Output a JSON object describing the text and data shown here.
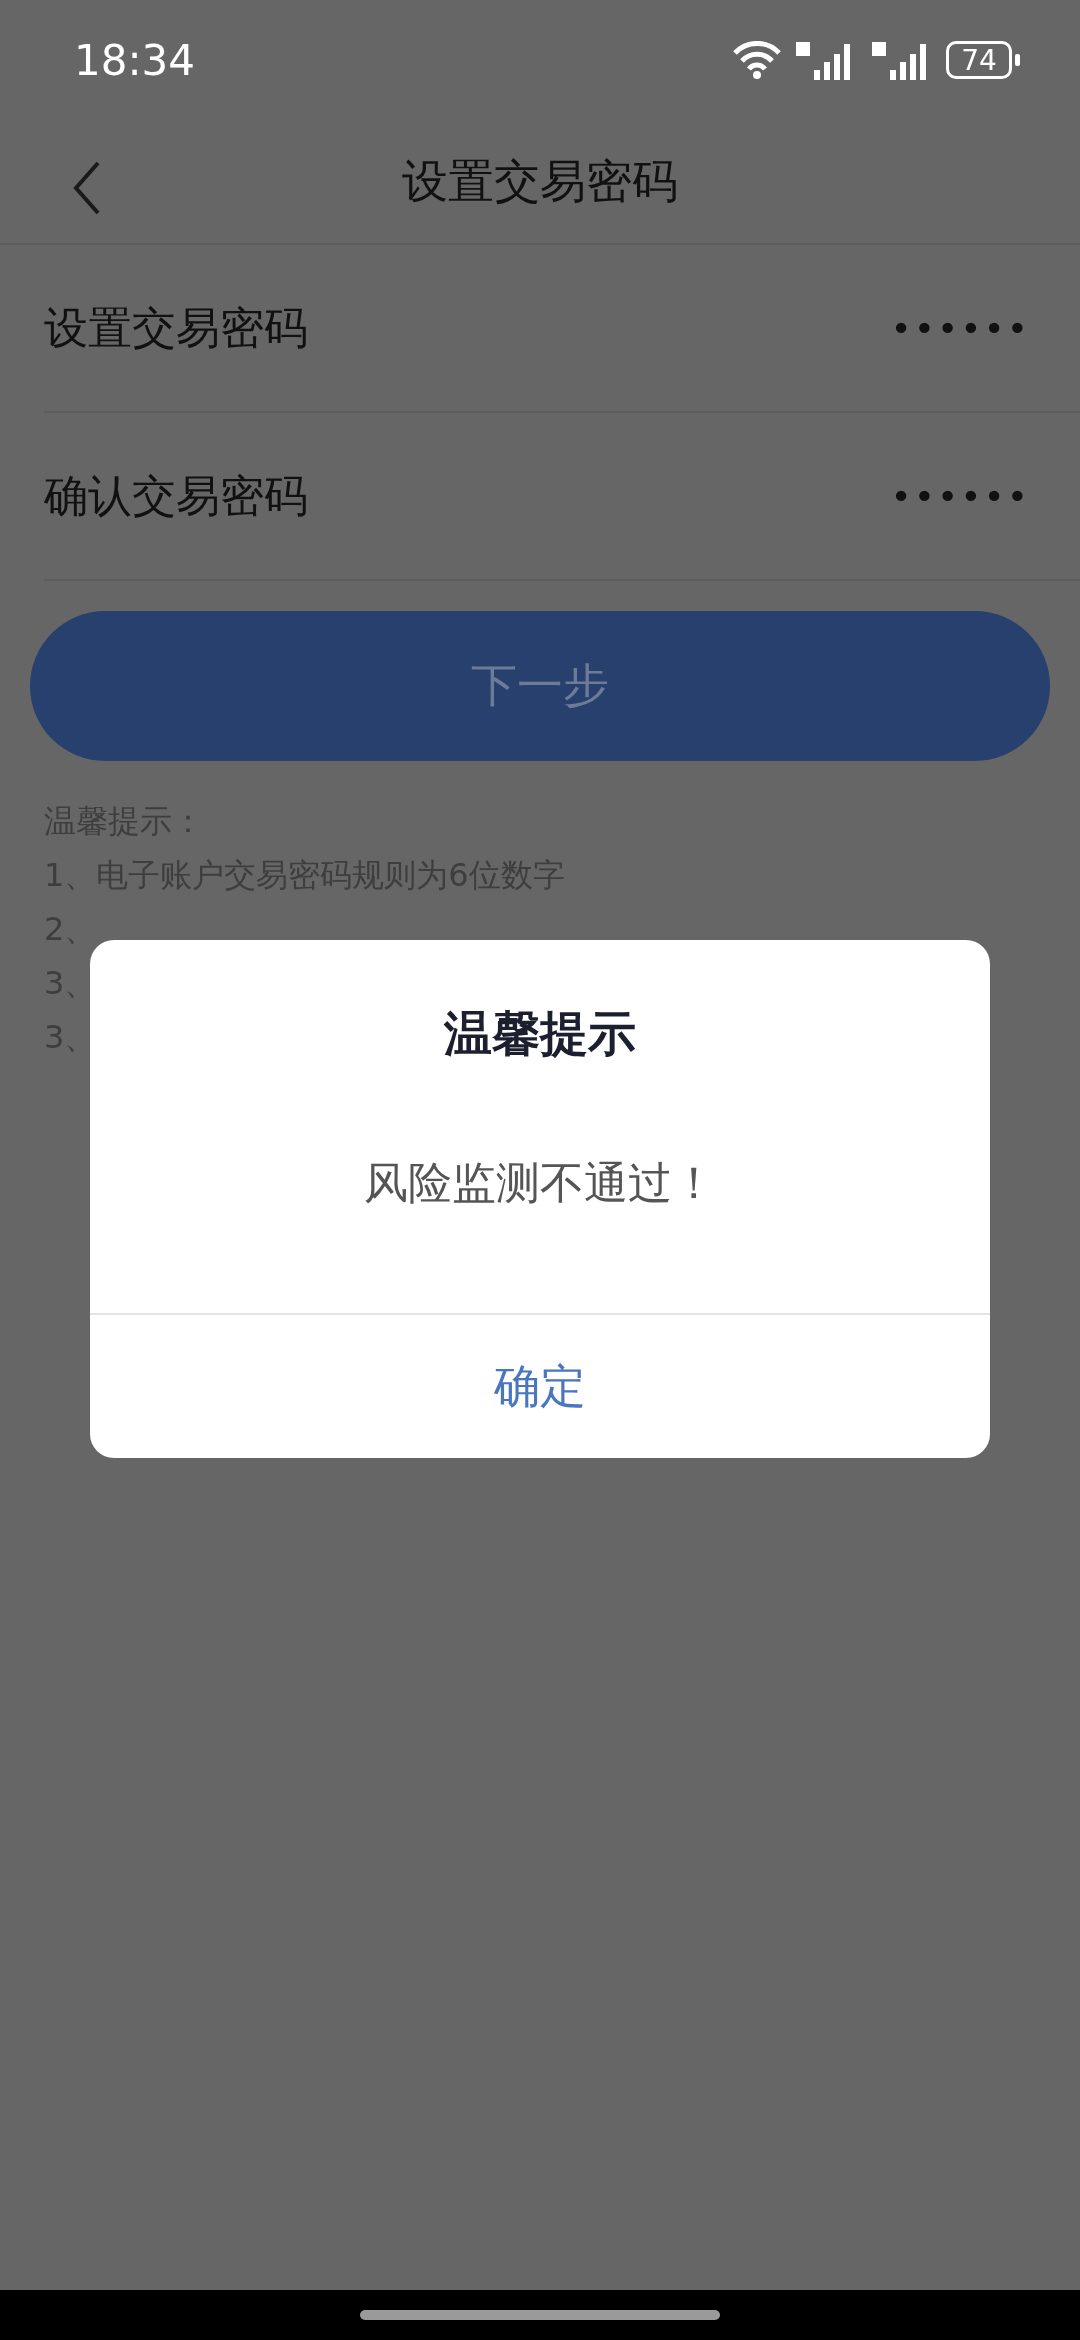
{
  "status_bar": {
    "time": "18:34",
    "battery": "74"
  },
  "header": {
    "title": "设置交易密码"
  },
  "fields": [
    {
      "label": "设置交易密码",
      "value": "••••••"
    },
    {
      "label": "确认交易密码",
      "value": "••••••"
    }
  ],
  "next_button": {
    "label": "下一步",
    "disabled": true
  },
  "tips": {
    "heading": "温馨提示：",
    "lines": [
      "1、电子账户交易密码规则为6位数字",
      "2、",
      "3、",
      "3、"
    ]
  },
  "dialog": {
    "title": "温馨提示",
    "message": "风险监测不通过！",
    "button": "确定"
  }
}
